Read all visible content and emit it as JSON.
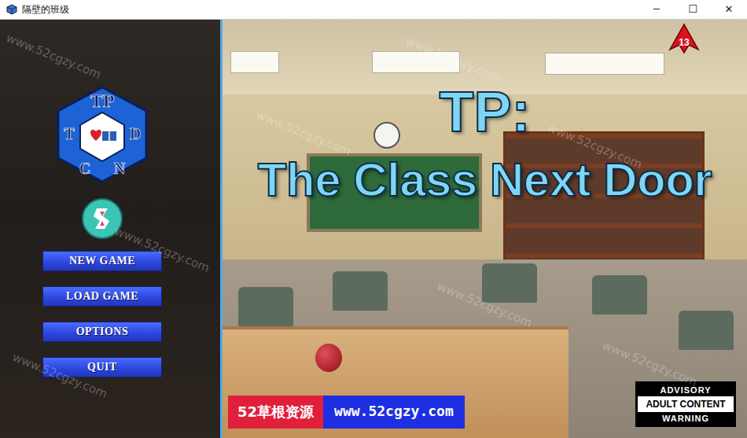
{
  "window": {
    "title": "隔壁的班级",
    "controls": [
      "─",
      "☐",
      "✕"
    ]
  },
  "logo": {
    "top": "TP",
    "left": "T",
    "right": "D",
    "bottom_left": "C",
    "bottom_right": "N"
  },
  "menu": [
    {
      "label": "NEW GAME"
    },
    {
      "label": "LOAD GAME"
    },
    {
      "label": "OPTIONS"
    },
    {
      "label": "QUIT"
    }
  ],
  "title": {
    "line1": "TP:",
    "line2": "The Class Next Door"
  },
  "rating_badge": "13",
  "advisory": [
    "ADVISORY",
    "ADULT CONTENT",
    "WARNING"
  ],
  "watermark": "www.52cgzy.com",
  "banner": {
    "name": "52草根资源",
    "url": "www.52cgzy.com"
  }
}
